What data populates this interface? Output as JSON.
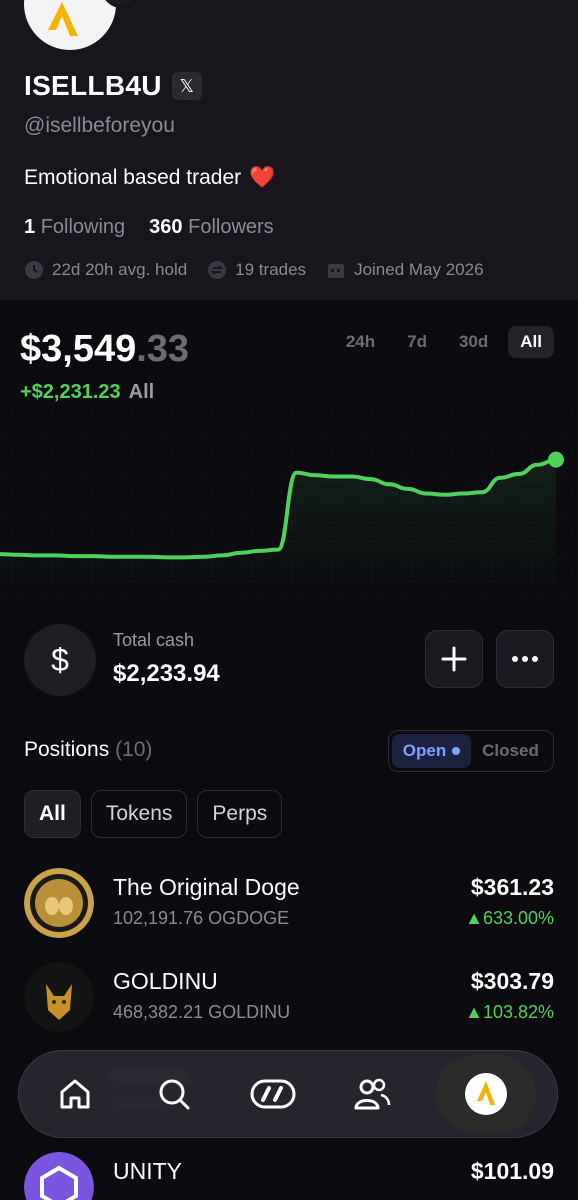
{
  "profile": {
    "name": "ISELLB4U",
    "x_badge": "𝕏",
    "handle": "@isellbeforeyou",
    "bio": "Emotional based trader",
    "bio_emoji": "❤️",
    "following_count": "1",
    "following_label": "Following",
    "followers_count": "360",
    "followers_label": "Followers",
    "avg_hold": "22d 20h avg. hold",
    "trades": "19 trades",
    "joined": "Joined May 2026"
  },
  "portfolio": {
    "balance_main": "$3,549",
    "balance_dec": ".33",
    "pnl": "+$2,231.23",
    "pnl_period": "All",
    "ranges": [
      "24h",
      "7d",
      "30d",
      "All"
    ],
    "active_range": "All",
    "line_color": "#4fd15b"
  },
  "chart_data": {
    "type": "line",
    "x": [
      0,
      1,
      2,
      3,
      4,
      5,
      6,
      7,
      8,
      9,
      10,
      11,
      12,
      13,
      14,
      15,
      16,
      17,
      18,
      19,
      20,
      21,
      22,
      23,
      24,
      25,
      26,
      27,
      28,
      29,
      30
    ],
    "values": [
      0.55,
      0.54,
      0.53,
      0.53,
      0.52,
      0.52,
      0.51,
      0.51,
      0.51,
      0.5,
      0.5,
      0.51,
      0.53,
      0.57,
      0.6,
      0.62,
      1.8,
      1.76,
      1.74,
      1.74,
      1.7,
      1.62,
      1.55,
      1.48,
      1.46,
      1.48,
      1.5,
      1.72,
      1.78,
      1.92,
      2.0
    ],
    "ylim": [
      0,
      2.3
    ]
  },
  "cash": {
    "label": "Total cash",
    "value": "$2,233.94",
    "icon": "dollar-icon"
  },
  "positions": {
    "title": "Positions",
    "count": "(10)",
    "open_label": "Open",
    "closed_label": "Closed",
    "filters": [
      "All",
      "Tokens",
      "Perps"
    ],
    "items": [
      {
        "name": "The Original Doge",
        "amount": "102,191.76 OGDOGE",
        "value": "$361.23",
        "change": "▲633.00%"
      },
      {
        "name": "GOLDINU",
        "amount": "468,382.21 GOLDINU",
        "value": "$303.79",
        "change": "▲103.82%"
      },
      {
        "name": "UNITY",
        "amount": "",
        "value": "$101.09",
        "change": ""
      }
    ]
  },
  "nav": [
    "home-icon",
    "search-icon",
    "trade-icon",
    "users-icon",
    "app-logo-icon"
  ]
}
